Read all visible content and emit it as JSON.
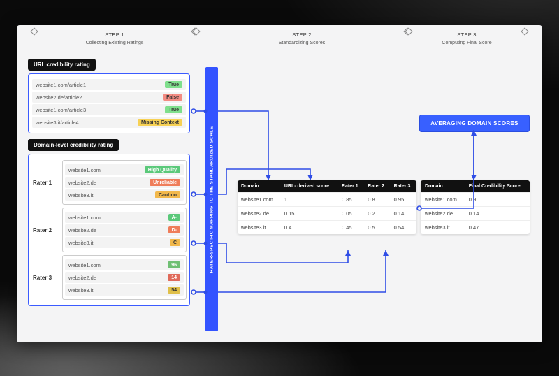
{
  "steps": [
    {
      "title": "STEP 1",
      "caption": "Collecting Existing Ratings"
    },
    {
      "title": "STEP 2",
      "caption": "Standardizing Scores"
    },
    {
      "title": "STEP 3",
      "caption": "Computing Final Score"
    }
  ],
  "url_panel": {
    "title": "URL credibility rating",
    "rows": [
      {
        "url": "website1.com/article1",
        "label": "True",
        "cls": "b-green"
      },
      {
        "url": "website2.de/article2",
        "label": "False",
        "cls": "b-red"
      },
      {
        "url": "website1.com/article3",
        "label": "True",
        "cls": "b-green"
      },
      {
        "url": "website3.it/article4",
        "label": "Missing Context",
        "cls": "b-yellow"
      }
    ]
  },
  "domain_panel": {
    "title": "Domain-level credibility rating",
    "raters": [
      {
        "name": "Rater 1",
        "rows": [
          {
            "site": "website1.com",
            "label": "High Quality",
            "cls": "b-dgreen"
          },
          {
            "site": "website2.de",
            "label": "Unreliable",
            "cls": "b-ored"
          },
          {
            "site": "website3.it",
            "label": "Caution",
            "cls": "b-oran"
          }
        ]
      },
      {
        "name": "Rater 2",
        "rows": [
          {
            "site": "website1.com",
            "label": "A-",
            "cls": "b-dgreen"
          },
          {
            "site": "website2.de",
            "label": "D-",
            "cls": "b-ored"
          },
          {
            "site": "website3.it",
            "label": "C",
            "cls": "b-oran"
          }
        ]
      },
      {
        "name": "Rater 3",
        "rows": [
          {
            "site": "website1.com",
            "label": "96",
            "cls": "b-gn"
          },
          {
            "site": "website2.de",
            "label": "14",
            "cls": "b-rn"
          },
          {
            "site": "website3.it",
            "label": "54",
            "cls": "b-yn"
          }
        ]
      }
    ]
  },
  "vbar_label": "RATER-SPECIFIC MAPPING TO THE STANDARDIZED SCALE",
  "mid_table": {
    "headers": [
      "Domain",
      "URL- derived score",
      "Rater 1",
      "Rater 2",
      "Rater 3"
    ],
    "rows": [
      [
        "website1.com",
        "1",
        "0.85",
        "0.8",
        "0.95"
      ],
      [
        "website2.de",
        "0.15",
        "0.05",
        "0.2",
        "0.14"
      ],
      [
        "website3.it",
        "0.4",
        "0.45",
        "0.5",
        "0.54"
      ]
    ]
  },
  "avg_label": "AVERAGING DOMAIN SCORES",
  "final_table": {
    "headers": [
      "Domain",
      "Final Credibility Score"
    ],
    "rows": [
      [
        "website1.com",
        "0.9"
      ],
      [
        "website2.de",
        "0.14"
      ],
      [
        "website3.it",
        "0.47"
      ]
    ]
  }
}
